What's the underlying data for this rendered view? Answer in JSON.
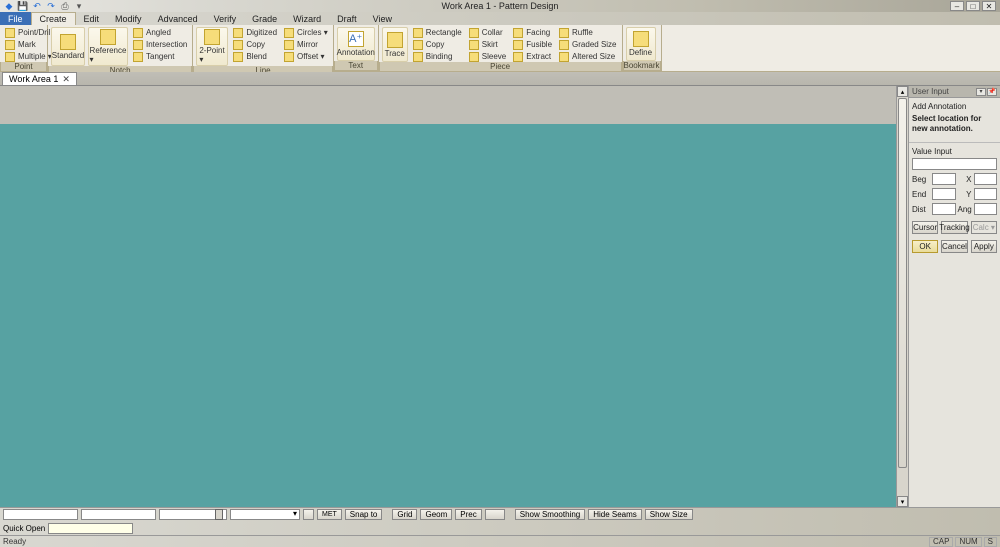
{
  "app": {
    "title": "Work Area 1 - Pattern Design"
  },
  "winbtns": {
    "min": "–",
    "max": "□",
    "close": "✕"
  },
  "qat": {
    "icons": [
      "app-icon",
      "save-icon",
      "undo-icon",
      "redo-icon",
      "print-icon",
      "dd-icon"
    ]
  },
  "menu": {
    "file": "File",
    "create": "Create",
    "edit": "Edit",
    "modify": "Modify",
    "advanced": "Advanced",
    "verify": "Verify",
    "grade": "Grade",
    "wizard": "Wizard",
    "draft": "Draft",
    "view": "View"
  },
  "ribbon": {
    "point": {
      "label": "Point",
      "pointdrill": "Point/Drill",
      "mark": "Mark",
      "multiple": "Multiple ▾"
    },
    "notch": {
      "label": "Notch",
      "standard": "Standard",
      "reference": "Reference ▾",
      "angled": "Angled",
      "intersection": "Intersection",
      "tangent": "Tangent"
    },
    "line": {
      "label": "Line",
      "twopoint": "2-Point ▾",
      "digitized": "Digitized",
      "copy": "Copy",
      "blend": "Blend",
      "circles": "Circles ▾",
      "mirror": "Mirror",
      "offset": "Offset ▾"
    },
    "text": {
      "label": "Text",
      "annotation": "Annotation"
    },
    "piece": {
      "label": "Piece",
      "trace": "Trace",
      "rectangle": "Rectangle",
      "copy2": "Copy",
      "binding": "Binding",
      "collar": "Collar",
      "skirt": "Skirt",
      "sleeve": "Sleeve",
      "facing": "Facing",
      "fusible": "Fusible",
      "extract": "Extract",
      "ruffle": "Ruffle",
      "graded": "Graded Size",
      "altered": "Altered Size"
    },
    "bookmark": {
      "label": "Bookmark",
      "define": "Define"
    }
  },
  "doctab": {
    "title": "Work Area 1",
    "close": "✕"
  },
  "sidepanel": {
    "head": "User Input",
    "addannotation": "Add Annotation",
    "prompt": "Select location for new annotation.",
    "valueinput": "Value Input",
    "beg": "Beg",
    "end": "End",
    "dist": "Dist",
    "x": "X",
    "y": "Y",
    "ang": "Ang",
    "cursor": "Cursor",
    "tracking": "Tracking",
    "calc": "Calc ▾",
    "ok": "OK",
    "cancel": "Cancel",
    "apply": "Apply"
  },
  "bottom": {
    "met": "MET",
    "snapto": "Snap to",
    "grid": "Grid",
    "geom": "Geom",
    "prec": "Prec",
    "showsmooth": "Show Smoothing",
    "hideseams": "Hide Seams",
    "showsize": "Show Size",
    "quickopen": "Quick Open"
  },
  "status": {
    "ready": "Ready",
    "cap": "CAP",
    "num": "NUM",
    "scrl": "S"
  }
}
